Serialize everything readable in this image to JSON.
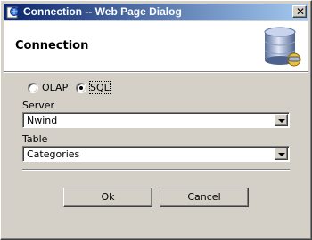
{
  "window": {
    "title": "Connection -- Web Page Dialog",
    "close_symbol": "✕"
  },
  "header": {
    "title": "Connection",
    "icon": "database-icon"
  },
  "source_type": {
    "options": [
      {
        "label": "OLAP",
        "checked": false
      },
      {
        "label": "SQL",
        "checked": true
      }
    ]
  },
  "server": {
    "label": "Server",
    "value": "Nwind"
  },
  "table": {
    "label": "Table",
    "value": "Categories"
  },
  "buttons": {
    "ok_label": "Ok",
    "cancel_label": "Cancel"
  },
  "colors": {
    "titlebar_start": "#0a246a",
    "titlebar_end": "#a6caf0",
    "dialog_bg": "#d4d0c8"
  }
}
